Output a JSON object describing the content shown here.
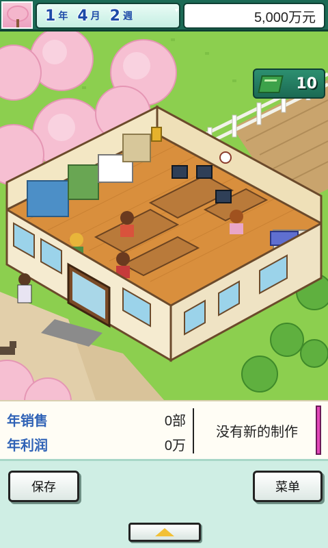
{
  "header": {
    "year": "1",
    "year_unit": "年",
    "month": "4",
    "month_unit": "月",
    "week": "2",
    "week_unit": "週",
    "money": "5,000万元"
  },
  "research_points": "10",
  "status": {
    "annual_sales_label": "年销售",
    "annual_sales_value": "0部",
    "annual_profit_label": "年利润",
    "annual_profit_value": "0万",
    "production_message": "没有新的制作"
  },
  "buttons": {
    "save": "保存",
    "menu": "菜单"
  },
  "icons": {
    "season": "cherry-blossom-icon",
    "research": "book-icon",
    "expand": "arrow-up-icon"
  },
  "colors": {
    "accent": "#1c6a55",
    "label_blue": "#2f62b6",
    "status_pink": "#e247b8"
  }
}
